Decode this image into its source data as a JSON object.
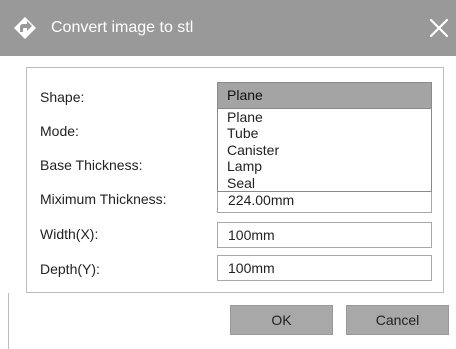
{
  "dialog": {
    "title": "Convert image to stl",
    "icon": "diamond-arrow-icon",
    "close_icon": "close-icon"
  },
  "form": {
    "shape_label": "Shape:",
    "mode_label": "Mode:",
    "base_thickness_label": "Base Thickness:",
    "max_thickness_label": "Miximum Thickness:",
    "width_label": "Width(X):",
    "depth_label": "Depth(Y):",
    "shape_selected": "Plane",
    "shape_options": [
      "Plane",
      "Tube",
      "Canister",
      "Lamp",
      "Seal"
    ],
    "max_thickness_value": "224.00mm",
    "width_value": "100mm",
    "depth_value": "100mm"
  },
  "buttons": {
    "ok": "OK",
    "cancel": "Cancel"
  },
  "colors": {
    "titlebar": "#999999",
    "button_bg": "#a8a8a8",
    "selected_bg": "#a4a4a4"
  }
}
